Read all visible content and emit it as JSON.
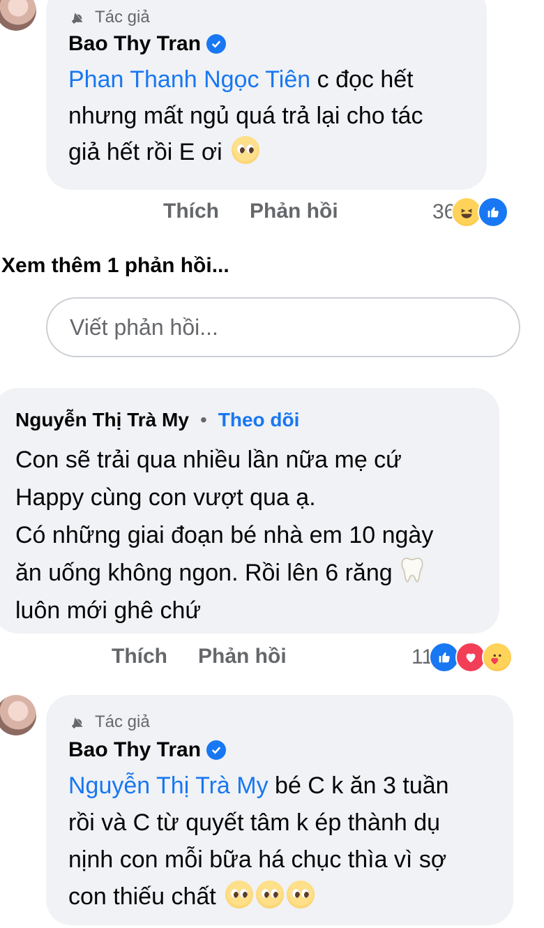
{
  "comments": [
    {
      "author_tag": "Tác giả",
      "author": "Bao Thy Tran",
      "mention": "Phan Thanh Ngọc Tiên",
      "lines": [
        "c đọc hết",
        "nhưng mất ngủ quá trả lại cho tác",
        "giả hết rồi E ơi"
      ],
      "like_label": "Thích",
      "reply_label": "Phản hồi",
      "reaction_count": "36",
      "reactions": [
        "haha-icon",
        "like-icon"
      ]
    },
    {
      "author": "Nguyễn Thị Trà My",
      "separator": "•",
      "follow_label": "Theo dõi",
      "lines": [
        "Con sẽ trải qua nhiều lần nữa mẹ cứ",
        "Happy cùng con vượt qua ạ.",
        "Có những giai đoạn bé nhà em 10 ngày",
        "ăn uống không ngon. Rồi lên 6 răng",
        "luôn mới ghê chứ"
      ],
      "like_label": "Thích",
      "reply_label": "Phản hồi",
      "reaction_count": "11",
      "reactions": [
        "like-icon",
        "love-icon",
        "care-icon"
      ]
    },
    {
      "author_tag": "Tác giả",
      "author": "Bao Thy Tran",
      "mention": "Nguyễn Thị Trà My",
      "lines": [
        "bé C k ăn 3 tuần",
        "rồi và C từ quyết tâm k ép thành dụ",
        "nịnh con mỗi bữa há chục thìa vì sợ",
        "con thiếu chất"
      ]
    }
  ],
  "see_more_replies": "Xem thêm 1 phản hồi...",
  "reply_input": {
    "placeholder": "Viết phản hồi...",
    "value": ""
  },
  "colors": {
    "link": "#1877f2",
    "bubble": "#f0f2f5",
    "muted": "#65676b"
  }
}
